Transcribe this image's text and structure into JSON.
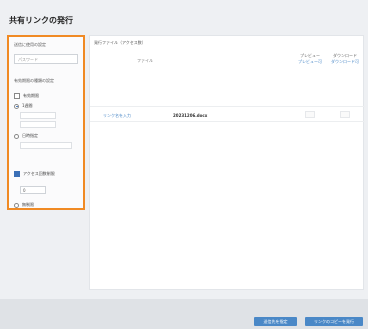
{
  "page": {
    "title": "共有リンクの発行"
  },
  "left_panel": {
    "password_label": "送信に使用の設定",
    "password_placeholder": "パスワード",
    "expiry_label": "有効期限の種類の設定",
    "options": [
      {
        "label": "有効期限",
        "selected": false,
        "kind": "check"
      },
      {
        "label": "1週間",
        "selected": true,
        "kind": "radio"
      },
      {
        "label": "日時指定",
        "selected": false,
        "kind": "radio"
      }
    ],
    "access_limit_label": "アクセス回数制限",
    "access_limit_checked": true,
    "access_count_value": "0",
    "no_limit_label": "無制限"
  },
  "main_panel": {
    "label": "発行ファイル（アクセス数）",
    "tab_label": "ファイル",
    "columns": [
      {
        "title": "プレビュー",
        "sub": "プレビュー可"
      },
      {
        "title": "ダウンロード",
        "sub": "ダウンロード可"
      }
    ],
    "row": {
      "link": "リンク名を入力",
      "filename": "20231206.docx"
    }
  },
  "footer": {
    "primary_button": "送信先を指定",
    "secondary_button": "リンクのコピーを発行"
  }
}
